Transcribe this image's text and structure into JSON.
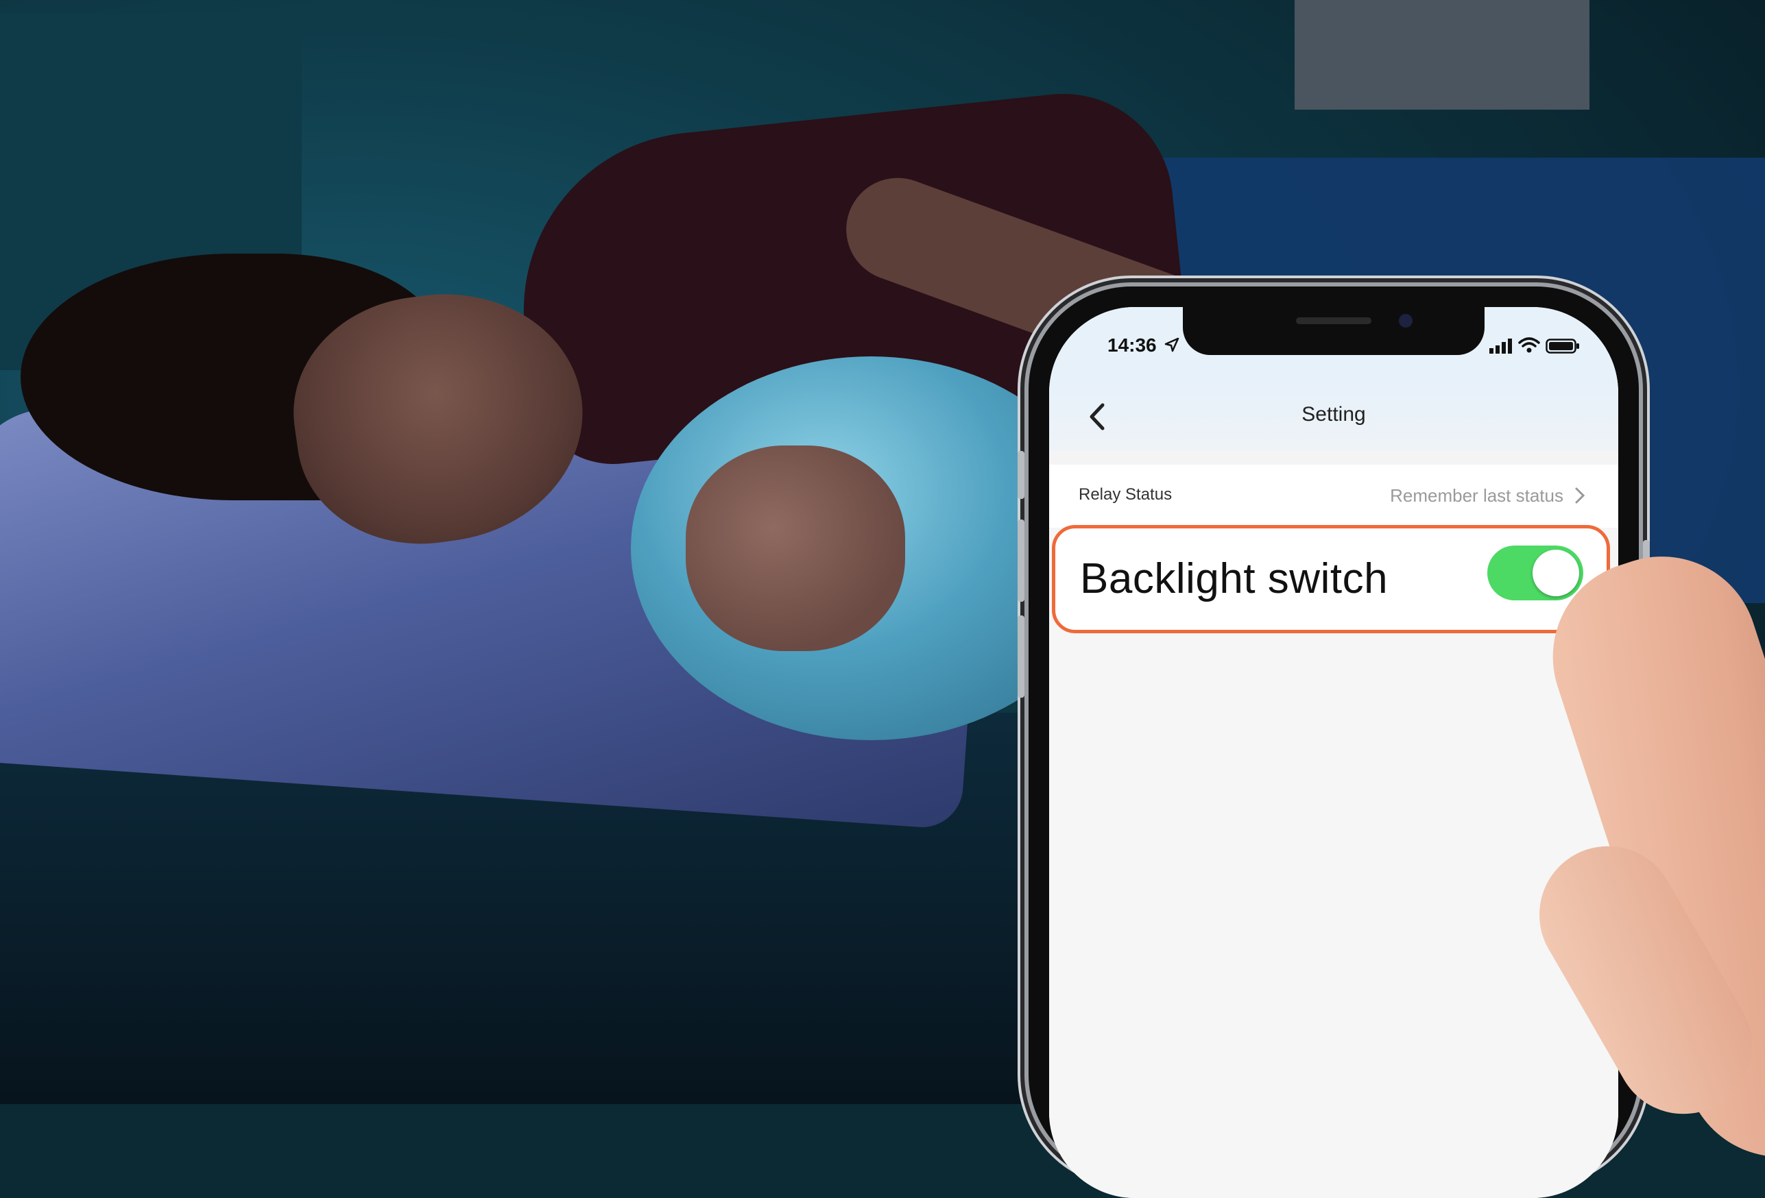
{
  "status_bar": {
    "time": "14:36"
  },
  "nav": {
    "title": "Setting"
  },
  "settings": {
    "relay_status": {
      "label": "Relay Status",
      "value": "Remember last status"
    },
    "backlight": {
      "label": "Backlight switch",
      "enabled": true
    }
  },
  "colors": {
    "highlight_border": "#ef6a3a",
    "toggle_on": "#4cd964"
  },
  "icons": [
    "location-arrow-icon",
    "signal-icon",
    "wifi-icon",
    "battery-icon",
    "back-icon",
    "chevron-right-icon"
  ]
}
